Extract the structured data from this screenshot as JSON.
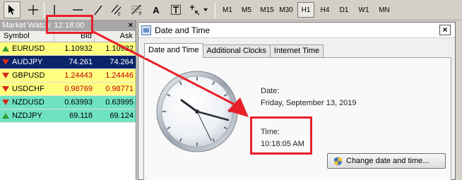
{
  "toolbar": {
    "text_label": "A",
    "timeframes": [
      "M1",
      "M5",
      "M15",
      "M30",
      "H1",
      "H4",
      "D1",
      "W1",
      "MN"
    ],
    "active_timeframe": "H1"
  },
  "market_watch": {
    "title": "Market Watch: 12:18:00",
    "close": "×",
    "columns": {
      "symbol": "Symbol",
      "bid": "Bid",
      "ask": "Ask"
    },
    "rows": [
      {
        "symbol": "EURUSD",
        "bid": "1.10932",
        "ask": "1.10932",
        "dir": "up",
        "color": "yellow"
      },
      {
        "symbol": "AUDJPY",
        "bid": "74.261",
        "ask": "74.264",
        "dir": "down",
        "color": "navy"
      },
      {
        "symbol": "GBPUSD",
        "bid": "1.24443",
        "ask": "1.24446",
        "dir": "down",
        "color": "yellow"
      },
      {
        "symbol": "USDCHF",
        "bid": "0.98769",
        "ask": "0.98771",
        "dir": "down",
        "color": "yellow"
      },
      {
        "symbol": "NZDUSD",
        "bid": "0.63993",
        "ask": "0.63995",
        "dir": "down",
        "color": "teal"
      },
      {
        "symbol": "NZDJPY",
        "bid": "69.118",
        "ask": "69.124",
        "dir": "up",
        "color": "teal"
      }
    ]
  },
  "dialog": {
    "title": "Date and Time",
    "close": "×",
    "tabs": [
      "Date and Time",
      "Additional Clocks",
      "Internet Time"
    ],
    "active_tab": 0,
    "date_label": "Date:",
    "date_value": "Friday, September 13, 2019",
    "time_label": "Time:",
    "time_value": "10:18:05 AM",
    "change_button": "Change date and time..."
  },
  "colors": {
    "highlight": "#e8202a",
    "row_yellow": "#ffff80",
    "row_navy": "#0a246a",
    "row_teal": "#6fe3c1",
    "price_red": "#c00000"
  },
  "icons": [
    "cursor-icon",
    "crosshair-icon",
    "vertical-line-icon",
    "horizontal-line-icon",
    "trendline-icon",
    "channel-icon",
    "fibonacci-icon",
    "text-icon",
    "text-label-icon",
    "arrows-icon",
    "close-icon",
    "clock-icon",
    "shield-icon"
  ]
}
